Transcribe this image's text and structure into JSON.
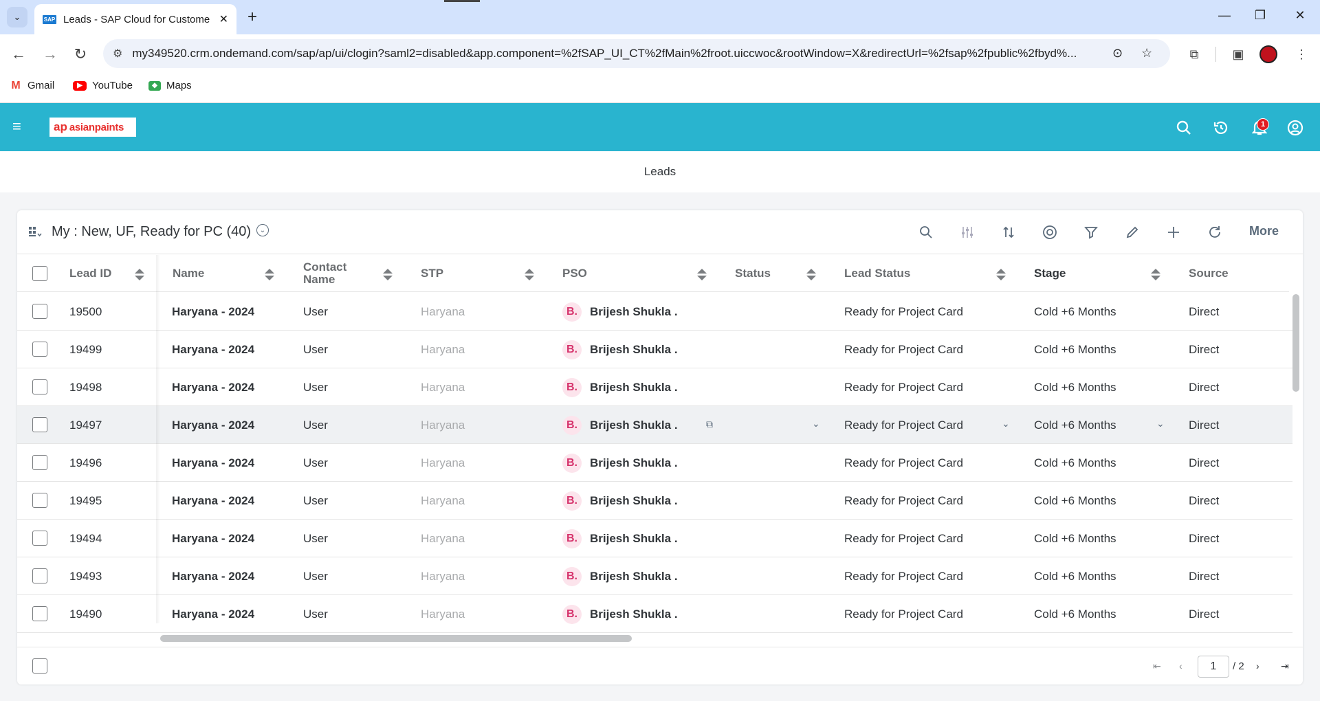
{
  "browser": {
    "tab_title": "Leads - SAP Cloud for Custome",
    "url": "my349520.crm.ondemand.com/sap/ap/ui/clogin?saml2=disabled&app.component=%2fSAP_UI_CT%2fMain%2froot.uiccwoc&rootWindow=X&redirectUrl=%2fsap%2fpublic%2fbyd%...",
    "bookmarks": [
      "Gmail",
      "YouTube",
      "Maps"
    ]
  },
  "shell": {
    "logo_text": "asianpaints",
    "notification_count": "1"
  },
  "page_title": "Leads",
  "view": {
    "title": "My : New, UF, Ready for PC  (40)",
    "more_label": "More"
  },
  "columns": {
    "lead_id": "Lead ID",
    "name": "Name",
    "contact_name_1": "Contact",
    "contact_name_2": "Name",
    "stp": "STP",
    "pso": "PSO",
    "status": "Status",
    "lead_status": "Lead Status",
    "stage": "Stage",
    "source": "Source"
  },
  "rows": [
    {
      "id": "19500",
      "name": "Haryana - 2024",
      "contact": "User",
      "stp": "Haryana",
      "avatar": "B.",
      "pso": "Brijesh Shukla .",
      "status": "",
      "lead_status": "Ready for Project Card",
      "stage": "Cold +6 Months",
      "source": "Direct"
    },
    {
      "id": "19499",
      "name": "Haryana - 2024",
      "contact": "User",
      "stp": "Haryana",
      "avatar": "B.",
      "pso": "Brijesh Shukla .",
      "status": "",
      "lead_status": "Ready for Project Card",
      "stage": "Cold +6 Months",
      "source": "Direct"
    },
    {
      "id": "19498",
      "name": "Haryana - 2024",
      "contact": "User",
      "stp": "Haryana",
      "avatar": "B.",
      "pso": "Brijesh Shukla .",
      "status": "",
      "lead_status": "Ready for Project Card",
      "stage": "Cold +6 Months",
      "source": "Direct"
    },
    {
      "id": "19497",
      "name": "Haryana - 2024",
      "contact": "User",
      "stp": "Haryana",
      "avatar": "B.",
      "pso": "Brijesh Shukla .",
      "status": "",
      "lead_status": "Ready for Project Card",
      "stage": "Cold +6 Months",
      "source": "Direct"
    },
    {
      "id": "19496",
      "name": "Haryana - 2024",
      "contact": "User",
      "stp": "Haryana",
      "avatar": "B.",
      "pso": "Brijesh Shukla .",
      "status": "",
      "lead_status": "Ready for Project Card",
      "stage": "Cold +6 Months",
      "source": "Direct"
    },
    {
      "id": "19495",
      "name": "Haryana - 2024",
      "contact": "User",
      "stp": "Haryana",
      "avatar": "B.",
      "pso": "Brijesh Shukla .",
      "status": "",
      "lead_status": "Ready for Project Card",
      "stage": "Cold +6 Months",
      "source": "Direct"
    },
    {
      "id": "19494",
      "name": "Haryana - 2024",
      "contact": "User",
      "stp": "Haryana",
      "avatar": "B.",
      "pso": "Brijesh Shukla .",
      "status": "",
      "lead_status": "Ready for Project Card",
      "stage": "Cold +6 Months",
      "source": "Direct"
    },
    {
      "id": "19493",
      "name": "Haryana - 2024",
      "contact": "User",
      "stp": "Haryana",
      "avatar": "B.",
      "pso": "Brijesh Shukla .",
      "status": "",
      "lead_status": "Ready for Project Card",
      "stage": "Cold +6 Months",
      "source": "Direct"
    },
    {
      "id": "19490",
      "name": "Haryana - 2024",
      "contact": "User",
      "stp": "Haryana",
      "avatar": "B.",
      "pso": "Brijesh Shukla .",
      "status": "",
      "lead_status": "Ready for Project Card",
      "stage": "Cold +6 Months",
      "source": "Direct"
    }
  ],
  "pagination": {
    "current_page": "1",
    "total_pages": "/ 2"
  },
  "colors": {
    "shell_bar": "#29b4cf",
    "brand_red": "#e8312f",
    "notification_badge": "#e11d23"
  }
}
